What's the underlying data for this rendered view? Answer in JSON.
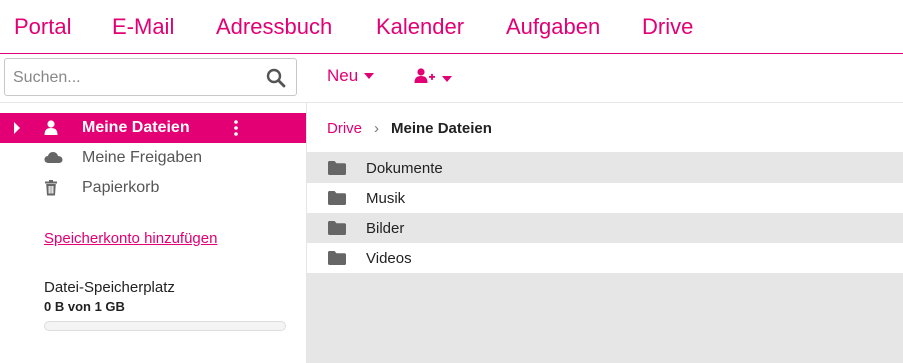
{
  "nav": {
    "tabs": [
      {
        "label": "Portal"
      },
      {
        "label": "E-Mail"
      },
      {
        "label": "Adressbuch"
      },
      {
        "label": "Kalender"
      },
      {
        "label": "Aufgaben"
      },
      {
        "label": "Drive"
      }
    ],
    "active_tab": "Drive"
  },
  "search": {
    "placeholder": "Suchen...",
    "value": ""
  },
  "toolbar": {
    "new_label": "Neu"
  },
  "sidebar": {
    "items": [
      {
        "label": "Meine Dateien",
        "icon": "user-icon",
        "active": true
      },
      {
        "label": "Meine Freigaben",
        "icon": "cloud-icon",
        "active": false
      },
      {
        "label": "Papierkorb",
        "icon": "trash-icon",
        "active": false
      }
    ],
    "add_storage_label": "Speicherkonto hinzufügen",
    "quota": {
      "title": "Datei-Speicherplatz",
      "value": "0 B von 1 GB",
      "used_fraction": 0
    }
  },
  "breadcrumb": {
    "root": "Drive",
    "separator": "›",
    "current": "Meine Dateien"
  },
  "files": [
    {
      "name": "Dokumente",
      "icon": "folder-icon"
    },
    {
      "name": "Musik",
      "icon": "folder-icon"
    },
    {
      "name": "Bilder",
      "icon": "folder-icon"
    },
    {
      "name": "Videos",
      "icon": "folder-icon"
    }
  ],
  "colors": {
    "accent": "#e20074",
    "row_alt": "#e6e6e6",
    "text": "#222222"
  }
}
